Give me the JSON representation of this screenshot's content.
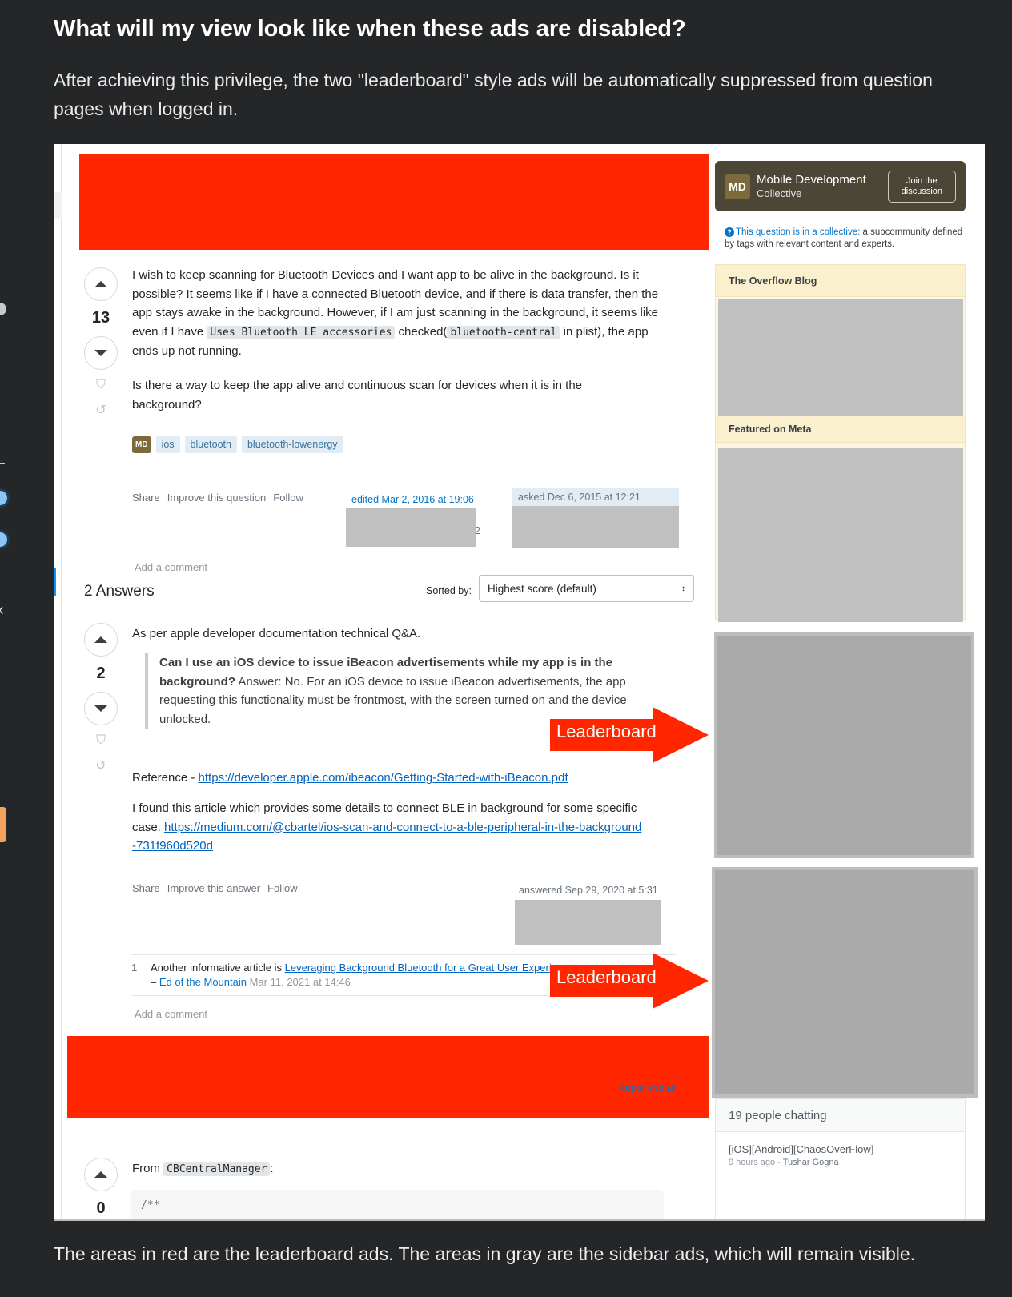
{
  "page": {
    "heading": "What will my view look like when these ads are disabled?",
    "intro": "After achieving this privilege, the two \"leaderboard\" style ads will be automatically suppressed from question pages when logged in.",
    "caption": "The areas in red are the leaderboard ads. The areas in gray are the sidebar ads, which will remain visible."
  },
  "colors": {
    "leaderboard_ad": "#ff2600",
    "sidebar_ad_light": "#c0c0c0",
    "sidebar_ad_dark": "#aaaaaa",
    "page_background": "#252628",
    "link": "#0063bf"
  },
  "annotations": {
    "arrow_label_1": "Leaderboard",
    "arrow_label_2": "Leaderboard"
  },
  "question": {
    "score": "13",
    "body_p1_a": "I wish to keep scanning for Bluetooth Devices and I want app to be alive in the background. Is it possible? It seems like if I have a connected Bluetooth device, and if there is data transfer, then the app stays awake in the background. However, if I am just scanning in the background, it seems like even if I have ",
    "code1": "Uses Bluetooth LE accessories",
    "body_p1_b": " checked(",
    "code2": "bluetooth-central",
    "body_p1_c": " in plist), the app ends up not running.",
    "body_p2": "Is there a way to keep the app alive and continuous scan for devices when it is in the background?",
    "collective_tag": "MD",
    "tags": [
      "ios",
      "bluetooth",
      "bluetooth-lowenergy"
    ],
    "menu": [
      "Share",
      "Improve this question",
      "Follow"
    ],
    "edited": "edited Mar 2, 2016 at 19:06",
    "edited_partial": "2",
    "asked": "asked Dec 6, 2015 at 12:21",
    "add_comment": "Add a comment"
  },
  "answers_header": {
    "title": "2 Answers",
    "sort_label": "Sorted by:",
    "sort_value": "Highest score (default)"
  },
  "answer1": {
    "score": "2",
    "intro": "As per apple developer documentation technical Q&A.",
    "quote_bold": "Can I use an iOS device to issue iBeacon advertisements while my app is in the background?",
    "quote_rest": " Answer: No. For an iOS device to issue iBeacon advertisements, the app requesting this functionality must be frontmost, with the screen turned on and the device unlocked.",
    "reference_label": "Reference - ",
    "reference_link": "https://developer.apple.com/ibeacon/Getting-Started-with-iBeacon.pdf",
    "article_text": "I found this article which provides some details to connect BLE in background for some specific case. ",
    "article_link": "https://medium.com/@cbartel/ios-scan-and-connect-to-a-ble-peripheral-in-the-background-731f960d520d",
    "menu": [
      "Share",
      "Improve this answer",
      "Follow"
    ],
    "answered": "answered Sep 29, 2020 at 5:31",
    "comment": {
      "score": "1",
      "text": "Another informative article is ",
      "link": "Leveraging Background Bluetooth for a Great User Experience",
      "dash": "– ",
      "user": "Ed of the Mountain",
      "date": " Mar 11, 2021 at 14:46"
    },
    "add_comment": "Add a comment"
  },
  "report_ad": "Report this ad",
  "answer2": {
    "score": "0",
    "from": "From ",
    "code": "CBCentralManager",
    "colon": ":",
    "code_block_first_line": "/**"
  },
  "sidebar": {
    "collective": {
      "badge": "MD",
      "name": "Mobile Development",
      "sub": "Collective",
      "join_label_1": "Join the",
      "join_label_2": "discussion",
      "note_link": "This question is in a collective:",
      "note_text": " a subcommunity defined by tags with relevant content and experts."
    },
    "blog_title": "The Overflow Blog",
    "meta_title": "Featured on Meta",
    "chat": {
      "title": "19 people chatting",
      "room": "[iOS][Android][ChaosOverFlow]",
      "time": "9 hours ago",
      "sep": " - ",
      "user": "Tushar Gogna"
    }
  }
}
